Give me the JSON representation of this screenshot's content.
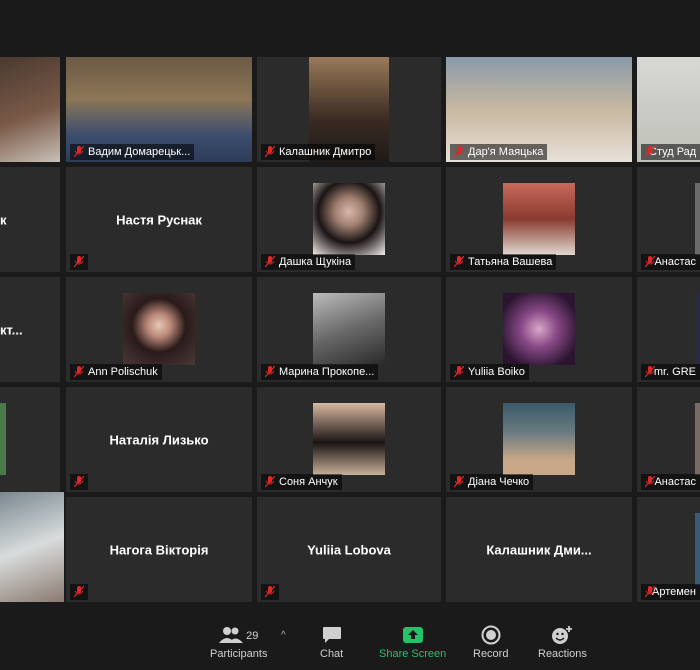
{
  "participants": [
    {
      "name": ""
    },
    {
      "name": "Вадим Домарецьк..."
    },
    {
      "name": "Калашник Дмитро"
    },
    {
      "name": "Дар'я Маяцька"
    },
    {
      "name": "Студ Рад"
    },
    {
      "name": "к"
    },
    {
      "name": "Настя Руснак"
    },
    {
      "name": "Дашка Щукіна"
    },
    {
      "name": "Татьяна Вашева"
    },
    {
      "name": "Анастас"
    },
    {
      "name": "кт..."
    },
    {
      "name": "Ann Polischuk"
    },
    {
      "name": "Марина Прокопе..."
    },
    {
      "name": "Yuliia Boiko"
    },
    {
      "name": "mr. GRE"
    },
    {
      "name": ""
    },
    {
      "name": "Наталія Лизько"
    },
    {
      "name": "Соня Анчук"
    },
    {
      "name": "Діана Чечко"
    },
    {
      "name": "Анастас"
    },
    {
      "name": ""
    },
    {
      "name": "Нагога Вікторія"
    },
    {
      "name": "Yuliia Lobova"
    },
    {
      "name": "Калашник Дми..."
    },
    {
      "name": "Артемен"
    }
  ],
  "toolbar": {
    "participants_label": "Participants",
    "participants_count": "29",
    "chat_label": "Chat",
    "share_label": "Share Screen",
    "record_label": "Record",
    "reactions_label": "Reactions"
  },
  "colors": {
    "active_border": "#c9e04a",
    "share_green": "#25c26a",
    "muted_red": "#e02828"
  }
}
